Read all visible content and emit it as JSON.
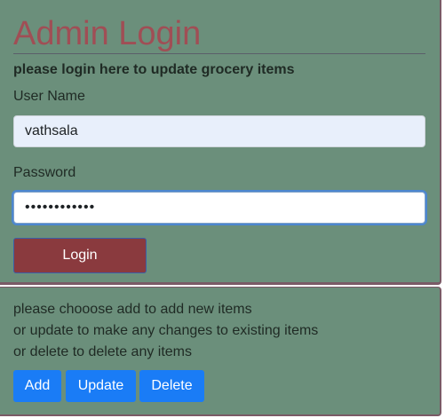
{
  "login": {
    "title": "Admin Login",
    "subtitle": "please login here to update grocery items",
    "username_label": "User Name",
    "username_value": "vathsala",
    "password_label": "Password",
    "password_value": "••••••••••••",
    "login_button": "Login"
  },
  "actions": {
    "line1": "please chooose add to add new items",
    "line2": "or update to make any changes to existing items",
    "line3": "or delete to delete any items",
    "add_button": "Add",
    "update_button": "Update",
    "delete_button": "Delete"
  },
  "colors": {
    "panel_bg": "#6b8f7b",
    "title": "#a04e55",
    "login_button": "#8a3a3e",
    "action_button": "#1a7cf6"
  }
}
